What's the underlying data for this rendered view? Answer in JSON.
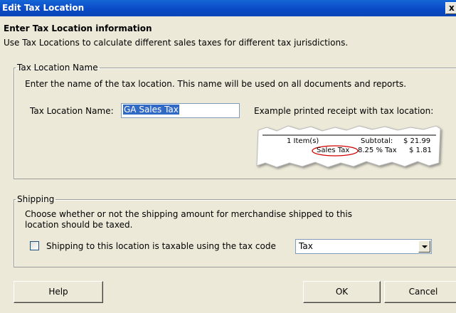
{
  "window": {
    "title": "Edit Tax Location",
    "close_glyph": "x"
  },
  "header": {
    "heading": "Enter Tax Location information",
    "description": "Use Tax Locations to calculate different sales taxes for different tax jurisdictions."
  },
  "tax_location_group": {
    "legend": "Tax Location Name",
    "instruction": "Enter the name of the tax location. This name will be used on all documents and reports.",
    "name_label": "Tax Location Name:",
    "name_value": "GA Sales Tax",
    "example_label": "Example printed receipt with tax location:",
    "receipt": {
      "line1_items": "1  Item(s)",
      "line1_subtotal_label": "Subtotal:",
      "line1_subtotal_value": "$ 21.99",
      "line2_tax_name": "Sales Tax",
      "line2_rate": "8.25 % Tax",
      "line2_tax_value": "$ 1.81"
    }
  },
  "shipping_group": {
    "legend": "Shipping",
    "instruction_line1": "Choose whether or not the shipping amount for merchandise shipped to this",
    "instruction_line2": "location should be taxed.",
    "checkbox_label": "Shipping to this location is taxable using the tax code",
    "checkbox_checked": false,
    "tax_code_selected": "Tax"
  },
  "buttons": {
    "help": "Help",
    "ok": "OK",
    "cancel": "Cancel"
  },
  "colors": {
    "title_bar": "#0a48c4",
    "dialog_bg": "#ECE9D8",
    "highlight": "#316ac5",
    "receipt_circle": "#d00000"
  }
}
